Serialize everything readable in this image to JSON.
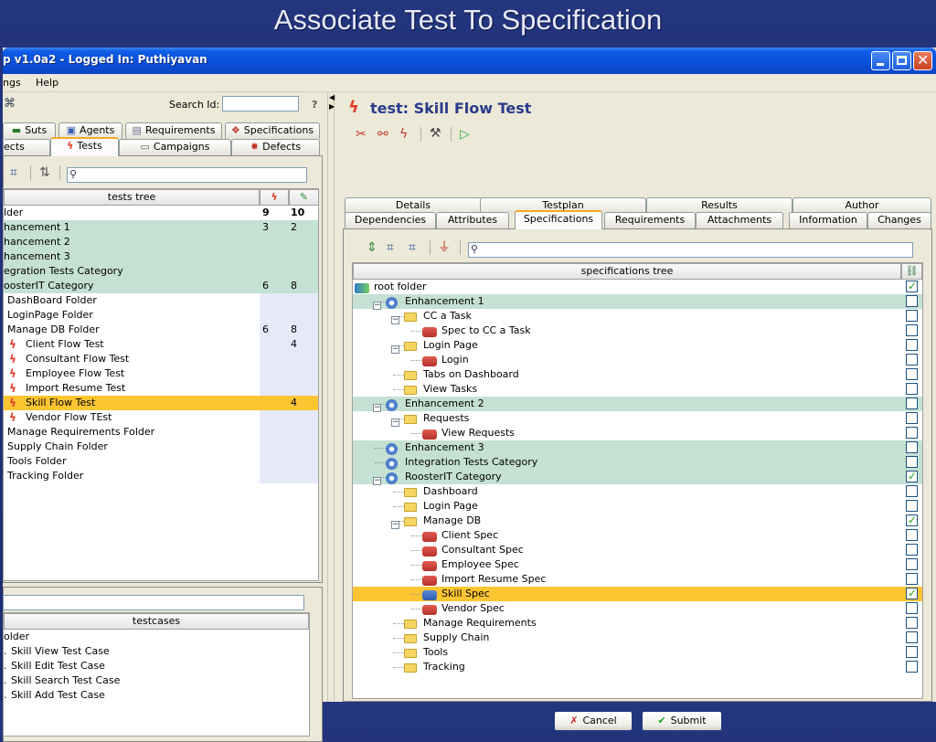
{
  "slide": {
    "title": "Associate Test To Specification"
  },
  "window": {
    "title": "p v1.0a2 - Logged In: Puthiyavan",
    "menu": [
      "ngs",
      "Help"
    ]
  },
  "left": {
    "search_label": "Search Id:",
    "search_value": "",
    "help_glyph": "?",
    "tabs_row1": [
      "Suts",
      "Agents",
      "Requirements",
      "Specifications"
    ],
    "tabs_row2": [
      "ects",
      "Tests",
      "Campaigns",
      "Defects"
    ],
    "tree_header": "tests tree",
    "tree_rows": [
      {
        "label": "lder",
        "n1": "9",
        "n2": "10",
        "bold": true
      },
      {
        "label": "hancement 1",
        "n1": "3",
        "n2": "2"
      },
      {
        "label": "hancement 2",
        "n1": "",
        "n2": ""
      },
      {
        "label": "hancement 3",
        "n1": "",
        "n2": ""
      },
      {
        "label": "egration Tests Category",
        "n1": "",
        "n2": ""
      },
      {
        "label": "oosterIT Category",
        "n1": "6",
        "n2": "8"
      },
      {
        "label": "DashBoard Folder",
        "n1": "",
        "n2": ""
      },
      {
        "label": "LoginPage Folder",
        "n1": "",
        "n2": ""
      },
      {
        "label": "Manage DB Folder",
        "n1": "6",
        "n2": "8"
      },
      {
        "label": "Client Flow Test",
        "n1": "",
        "n2": "4"
      },
      {
        "label": "Consultant Flow Test",
        "n1": "",
        "n2": ""
      },
      {
        "label": "Employee Flow Test",
        "n1": "",
        "n2": ""
      },
      {
        "label": "Import Resume Test",
        "n1": "",
        "n2": ""
      },
      {
        "label": "Skill Flow Test",
        "n1": "",
        "n2": "4"
      },
      {
        "label": "Vendor Flow TEst",
        "n1": "",
        "n2": ""
      },
      {
        "label": "Manage Requirements Folder",
        "n1": "",
        "n2": ""
      },
      {
        "label": "Supply Chain Folder",
        "n1": "",
        "n2": ""
      },
      {
        "label": "Tools Folder",
        "n1": "",
        "n2": ""
      },
      {
        "label": "Tracking Folder",
        "n1": "",
        "n2": ""
      }
    ],
    "testcases_header": "testcases",
    "testcases": [
      "older",
      "Skill View Test Case",
      "Skill Edit Test Case",
      "Skill Search Test Case",
      "Skill Add Test Case"
    ]
  },
  "right": {
    "title": "test: Skill Flow Test",
    "tabs_row1": [
      "Details",
      "Testplan",
      "Results",
      "Author"
    ],
    "tabs_row2": [
      "Dependencies",
      "Attributes",
      "Specifications",
      "Requirements",
      "Attachments",
      "Information",
      "Changes"
    ],
    "spec_header": "specifications tree",
    "spec_rows": [
      {
        "label": "root folder",
        "checked": true
      },
      {
        "label": "Enhancement 1",
        "checked": false
      },
      {
        "label": "CC a Task",
        "checked": false
      },
      {
        "label": "Spec to CC a Task",
        "checked": false
      },
      {
        "label": "Login Page",
        "checked": false
      },
      {
        "label": "Login",
        "checked": false
      },
      {
        "label": "Tabs on Dashboard",
        "checked": false
      },
      {
        "label": "View Tasks",
        "checked": false
      },
      {
        "label": "Enhancement 2",
        "checked": false
      },
      {
        "label": "Requests",
        "checked": false
      },
      {
        "label": "View Requests",
        "checked": false
      },
      {
        "label": "Enhancement 3",
        "checked": false
      },
      {
        "label": "Integration Tests Category",
        "checked": false
      },
      {
        "label": "RoosterIT Category",
        "checked": true
      },
      {
        "label": "Dashboard",
        "checked": false
      },
      {
        "label": "Login Page",
        "checked": false
      },
      {
        "label": "Manage DB",
        "checked": true
      },
      {
        "label": "Client Spec",
        "checked": false
      },
      {
        "label": "Consultant Spec",
        "checked": false
      },
      {
        "label": "Employee Spec",
        "checked": false
      },
      {
        "label": "Import Resume Spec",
        "checked": false
      },
      {
        "label": "Skill Spec",
        "checked": true
      },
      {
        "label": "Vendor Spec",
        "checked": false
      },
      {
        "label": "Manage Requirements",
        "checked": false
      },
      {
        "label": "Supply Chain",
        "checked": false
      },
      {
        "label": "Tools",
        "checked": false
      },
      {
        "label": "Tracking",
        "checked": false
      }
    ],
    "cancel_label": "Cancel",
    "submit_label": "Submit"
  },
  "colors": {
    "selection": "#fdc532",
    "category": "#c4e1d3",
    "titlebar": "#0a4fd8",
    "slide_bg": "#23357d"
  }
}
